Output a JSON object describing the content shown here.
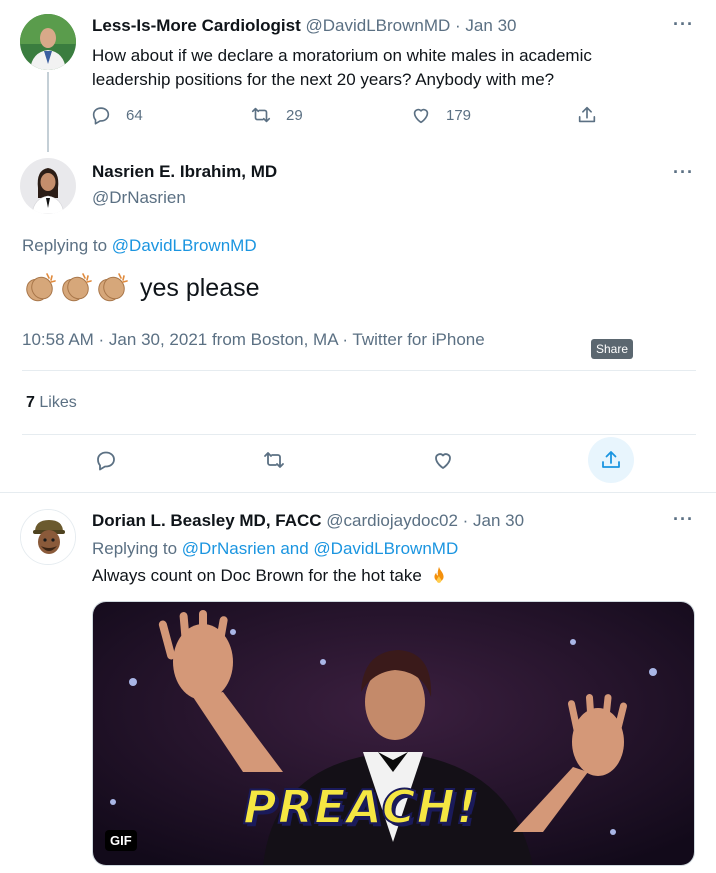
{
  "tweet1": {
    "name": "Less-Is-More Cardiologist",
    "handle": "@DavidLBrownMD",
    "time": "· Jan 30",
    "text": "How about if we declare a moratorium on white males in academic leadership positions for the next 20 years? Anybody with me?",
    "replies": "64",
    "retweets": "29",
    "likes": "179"
  },
  "main": {
    "name": "Nasrien E. Ibrahim, MD",
    "handle": "@DrNasrien",
    "replying_prefix": "Replying to",
    "replying_to": "@DavidLBrownMD",
    "text": "yes please",
    "timestamp": "10:58 AM · Jan 30, 2021 from Boston, MA · Twitter for iPhone",
    "likes_count": "7",
    "likes_label": "Likes",
    "share_tooltip": "Share"
  },
  "tweet3": {
    "name": "Dorian L. Beasley MD, FACC",
    "handle": "@cardiojaydoc02",
    "time": "· Jan 30",
    "replying_prefix": "Replying to",
    "replying_to_1": "@DrNasrien",
    "replying_and": "and",
    "replying_to_2": "@DavidLBrownMD",
    "text": "Always count on Doc Brown for the hot take",
    "gif_badge": "GIF",
    "gif_caption": "PREACH!"
  },
  "more_label": "···",
  "icons": {
    "reply": "reply-icon",
    "retweet": "retweet-icon",
    "like": "heart-icon",
    "share": "share-icon",
    "more": "more-icon",
    "clap": "clapping-hands-icon",
    "fire": "fire-icon"
  },
  "colors": {
    "link": "#1b95e0",
    "muted": "#5b7083",
    "text": "#0f1419",
    "divider": "#e6ecf0"
  }
}
